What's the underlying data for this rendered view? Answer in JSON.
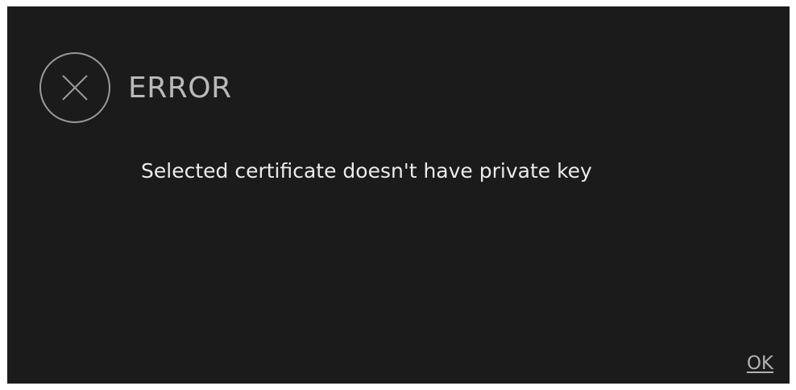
{
  "dialog": {
    "title": "ERROR",
    "icon": "error-circle-x-icon",
    "message": "Selected certificate doesn't have private key",
    "ok_label": "OK"
  },
  "colors": {
    "background": "#1b1b1b",
    "title": "#b9b9b9",
    "message": "#ebebeb",
    "icon_stroke": "#9a9a9a",
    "button": "#b0b0b0"
  }
}
